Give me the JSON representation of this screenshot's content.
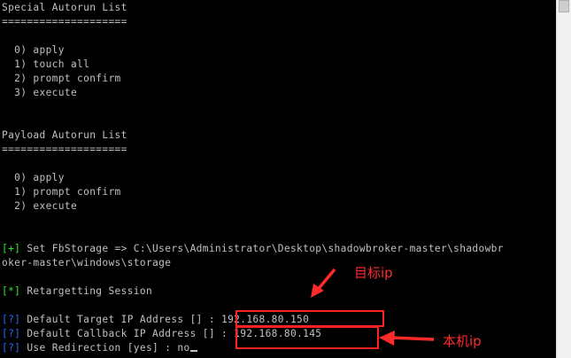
{
  "console": {
    "lines": [
      {
        "row": 0,
        "text": "Special Autorun List"
      },
      {
        "row": 1,
        "text": "===================="
      },
      {
        "row": 3,
        "text": "  0) apply"
      },
      {
        "row": 4,
        "text": "  1) touch all"
      },
      {
        "row": 5,
        "text": "  2) prompt confirm"
      },
      {
        "row": 6,
        "text": "  3) execute"
      },
      {
        "row": 9,
        "text": "Payload Autorun List"
      },
      {
        "row": 10,
        "text": "===================="
      },
      {
        "row": 12,
        "text": "  0) apply"
      },
      {
        "row": 13,
        "text": "  1) prompt confirm"
      },
      {
        "row": 14,
        "text": "  2) execute"
      },
      {
        "row": 17,
        "tag": "[+]",
        "tag_color": "green",
        "text": " Set FbStorage => C:\\Users\\Administrator\\Desktop\\shadowbroker-master\\shadowbr"
      },
      {
        "row": 18,
        "text": "oker-master\\windows\\storage"
      },
      {
        "row": 20,
        "tag": "[*]",
        "tag_color": "green",
        "text": " Retargetting Session"
      },
      {
        "row": 22,
        "tag": "[?]",
        "tag_color": "blue",
        "text": " Default Target IP Address [] : 192.168.80.150"
      },
      {
        "row": 23,
        "tag": "[?]",
        "tag_color": "blue",
        "text": " Default Callback IP Address [] : 192.168.80.145"
      },
      {
        "row": 24,
        "tag": "[?]",
        "tag_color": "blue",
        "text": " Use Redirection [yes] : no",
        "cursor": true
      }
    ]
  },
  "annotations": {
    "target_label": "目标ip",
    "local_label": "本机ip"
  },
  "colors": {
    "console_bg": "#000000",
    "console_text": "#c0c0c0",
    "tag_green": "#2ee82e",
    "tag_blue": "#1e6cff",
    "annotation_red": "#ff2a2a"
  }
}
